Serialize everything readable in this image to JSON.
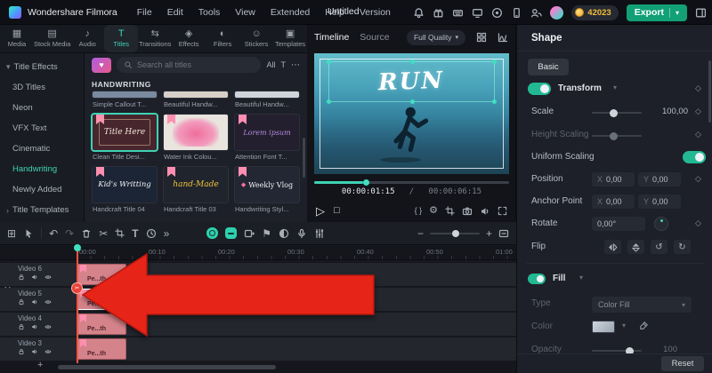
{
  "icons": {
    "chevron_down": "▾",
    "chevron_right": "›",
    "double_chevron": "»",
    "more": "⋯",
    "undo": "↶",
    "redo": "↷",
    "scissors": "✂",
    "gear": "⚙",
    "flag": "⚑",
    "heart": "♥",
    "play": "▷",
    "stop": "□",
    "brackets": "{ }",
    "diamond": "◇",
    "minus": "−",
    "plus": "+",
    "apps": "⊞",
    "text_tool": "T",
    "rotate_ccw": "↺",
    "rotate_cw": "↻"
  },
  "menubar": {
    "app": "Wondershare Filmora",
    "menus": [
      "File",
      "Edit",
      "Tools",
      "View",
      "Extended",
      "Help",
      "Version"
    ],
    "title": "Untitled",
    "coins": "42023",
    "export": "Export"
  },
  "media_panel": {
    "tabs": [
      {
        "label": "Media",
        "icon": "▦"
      },
      {
        "label": "Stock Media",
        "icon": "▤"
      },
      {
        "label": "Audio",
        "icon": "♪"
      },
      {
        "label": "Titles",
        "icon": "T"
      },
      {
        "label": "Transitions",
        "icon": "⇆"
      },
      {
        "label": "Effects",
        "icon": "◈"
      },
      {
        "label": "Filters",
        "icon": "◐"
      },
      {
        "label": "Stickers",
        "icon": "☺"
      },
      {
        "label": "Templates",
        "icon": "▣"
      }
    ],
    "search_placeholder": "Search all titles",
    "filter_all": "All",
    "sidebar": [
      "Title Effects",
      "3D Titles",
      "Neon",
      "VFX Text",
      "Cinematic",
      "Handwriting",
      "Newly Added",
      "Title Templates"
    ],
    "section": "HANDWRITING",
    "partial_labels": [
      "Simple Callout T...",
      "Beautiful Handw...",
      "Beautiful Handw..."
    ],
    "items": [
      {
        "thumb": "Title Here",
        "name": "Clean Title Desi..."
      },
      {
        "thumb": "",
        "name": "Water Ink Colou..."
      },
      {
        "thumb": "Lorem ipsum",
        "name": "Attention Font T..."
      },
      {
        "thumb": "Kid's Writting",
        "name": "Handcraft Title 04"
      },
      {
        "thumb": "hand-Made",
        "name": "Handcraft Title 03"
      },
      {
        "thumb": "Weekly Vlog",
        "name": "Handwriting Styl...",
        "prefix": "◆"
      }
    ]
  },
  "preview": {
    "tabs": [
      "Timeline",
      "Source"
    ],
    "quality": "Full Quality",
    "overlay_text": "RUN",
    "current_time": "00:00:01:15",
    "separator": "/",
    "total_time": "00:00:06:15"
  },
  "inspector": {
    "title": "Shape",
    "basic": "Basic",
    "transform": "Transform",
    "scale": "Scale",
    "scale_value": "100,00",
    "height_scaling": "Height Scaling",
    "uniform_scaling": "Uniform Scaling",
    "position": "Position",
    "pos_x": "0,00",
    "pos_y": "0,00",
    "anchor_point": "Anchor Point",
    "anchor_x": "0,00",
    "anchor_y": "0,00",
    "rotate": "Rotate",
    "rotate_value": "0,00°",
    "flip": "Flip",
    "fill": "Fill",
    "type": "Type",
    "type_value": "Color Fill",
    "color": "Color",
    "opacity": "Opacity",
    "opacity_value": "100",
    "x_label": "X",
    "y_label": "Y",
    "reset": "Reset"
  },
  "timeline": {
    "ruler": [
      "00:00",
      "00:10",
      "00:20",
      "00:30",
      "00:40",
      "00:50",
      "01:00"
    ],
    "tracks": [
      {
        "name": "Video 6",
        "clip": "Pe...th"
      },
      {
        "name": "Video 5",
        "clip": "Pe...th"
      },
      {
        "name": "Video 4",
        "clip": "Pe...th"
      },
      {
        "name": "Video 3",
        "clip": "Pe...th"
      }
    ]
  }
}
